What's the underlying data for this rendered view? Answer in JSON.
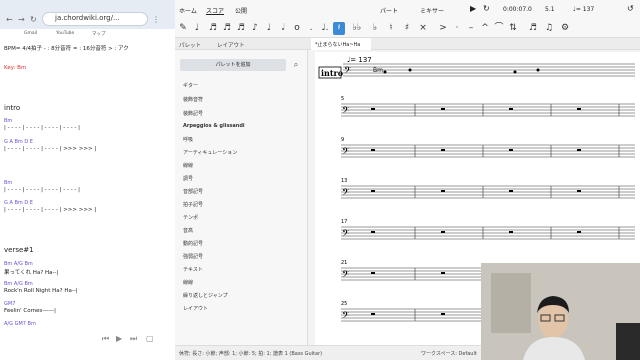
{
  "browser": {
    "url": "ja.chordwiki.org/...",
    "bookmarks": [
      "Gmail",
      "YouTube",
      "マップ"
    ],
    "header_line": "BPM=    4/4拍子  - : 8分音符  = : 16分音符  > : アク",
    "key": "Key: Bm",
    "sections": [
      {
        "title": "intro",
        "lines": [
          {
            "chords": "Bm",
            "notes": "| - - - - | - - - - | - - - - | - - - - |"
          },
          {
            "chords": "G            A           Bm         D         E",
            "notes": "| - - - - | - - - - | - - - - | >>> >>> |"
          },
          {
            "chords": "Bm",
            "notes": "| - - - - | - - - - | - - - - | - - - - |"
          },
          {
            "chords": "G            A           Bm         D         E",
            "notes": "| - - - - | - - - - | - - - - | >>> >>> |"
          }
        ]
      },
      {
        "title": "verse#1",
        "lines": [
          {
            "chords": "Bm                          A/G          Bm",
            "notes": "   果ってくれ     Ha?     Ha--|"
          },
          {
            "chords": "Bm                          A/G          Bm",
            "notes": "   Rock'n Roll Night     Ha?     Ha--|"
          },
          {
            "chords": "GM7",
            "notes": "   Feelin' Comes------|"
          },
          {
            "chords": "A/G                       GM7                        Bm",
            "notes": ""
          }
        ]
      }
    ]
  },
  "app": {
    "menu": [
      "ホーム",
      "スコア",
      "公開"
    ],
    "right_menu": [
      "パート",
      "ミキサー"
    ],
    "time": "0:00:07.0",
    "position": "5.1",
    "tempo": "♩= 137",
    "tabs": [
      "パレット",
      "レイアウト"
    ],
    "doc_tab": "*止まらないHa~Ha",
    "palette_add": "パレットを追加",
    "palette_items": [
      "ギター",
      "装飾音符",
      "装飾記号",
      "Arpeggios & glissandi",
      "呼吸",
      "アーティキュレーション",
      "線線",
      "調号",
      "音部記号",
      "拍子記号",
      "テンポ",
      "音高",
      "動的記号",
      "強弱記号",
      "テキスト",
      "線線",
      "繰り返しとジャンプ",
      "レイアウト"
    ],
    "score": {
      "tempo_mark": "♩= 137",
      "chord": "Bm",
      "rehearsal": "intro",
      "measure_numbers": [
        "5",
        "9",
        "13",
        "17",
        "21",
        "25"
      ]
    },
    "status_left": "休符; 長さ: 小節; 声部: 1; 小節: 5; 拍: 1; 譜表 1 (Bass Guitar)",
    "status_right": "ワークスペース: Default"
  }
}
